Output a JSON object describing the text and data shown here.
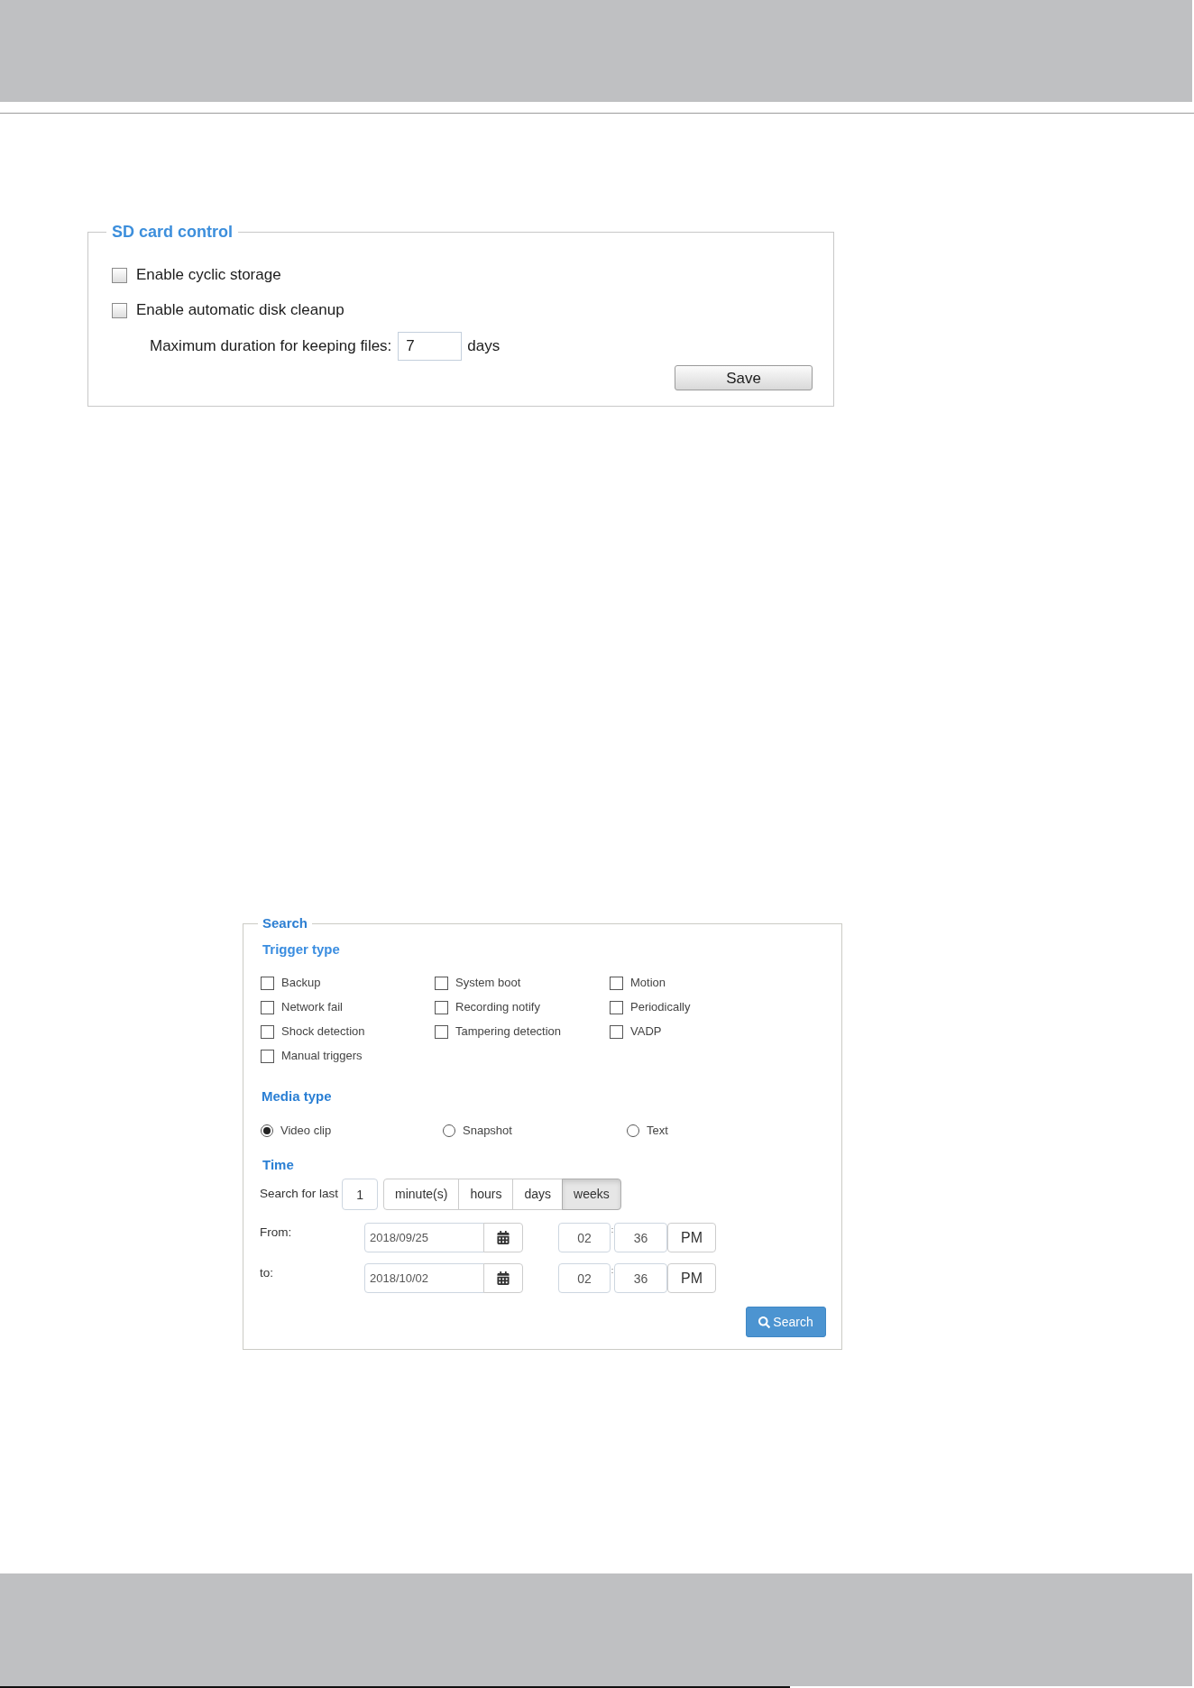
{
  "sd_card_control": {
    "title": "SD card control",
    "options": [
      {
        "label": "Enable cyclic storage",
        "checked": false
      },
      {
        "label": "Enable automatic disk cleanup",
        "checked": false
      }
    ],
    "retention": {
      "label": "Maximum duration for keeping files:",
      "value": "7",
      "unit": "days"
    },
    "save_button": "Save"
  },
  "search": {
    "title": "Search",
    "trigger_type": {
      "heading": "Trigger type",
      "options": [
        {
          "label": "Backup",
          "checked": false
        },
        {
          "label": "System boot",
          "checked": false
        },
        {
          "label": "Motion",
          "checked": false
        },
        {
          "label": "Network fail",
          "checked": false
        },
        {
          "label": "Recording notify",
          "checked": false
        },
        {
          "label": "Periodically",
          "checked": false
        },
        {
          "label": "Shock detection",
          "checked": false
        },
        {
          "label": "Tampering detection",
          "checked": false
        },
        {
          "label": "VADP",
          "checked": false
        },
        {
          "label": "Manual triggers",
          "checked": false
        }
      ]
    },
    "media_type": {
      "heading": "Media type",
      "options": [
        {
          "label": "Video clip",
          "selected": true
        },
        {
          "label": "Snapshot",
          "selected": false
        },
        {
          "label": "Text",
          "selected": false
        }
      ]
    },
    "time": {
      "heading": "Time",
      "search_for_last": {
        "label": "Search for last",
        "value": "1",
        "units": [
          {
            "label": "minute(s)",
            "selected": false
          },
          {
            "label": "hours",
            "selected": false
          },
          {
            "label": "days",
            "selected": false
          },
          {
            "label": "weeks",
            "selected": true
          }
        ]
      },
      "range": [
        {
          "label": "From:",
          "date": "2018/09/25",
          "hour": "02",
          "separator": ":",
          "minute": "36",
          "period": "PM"
        },
        {
          "label": "to:",
          "date": "2018/10/02",
          "hour": "02",
          "separator": ":",
          "minute": "36",
          "period": "PM"
        }
      ]
    },
    "search_button": "Search"
  }
}
